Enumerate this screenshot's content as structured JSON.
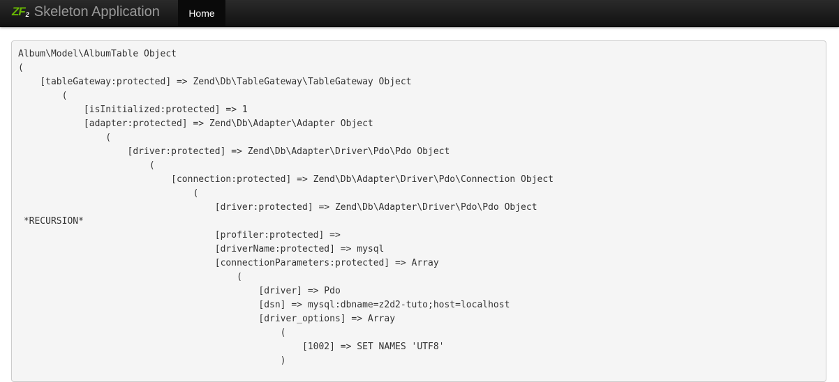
{
  "header": {
    "logo_text": "ZF",
    "logo_version": "2",
    "brand": "Skeleton Application",
    "nav": [
      {
        "label": "Home"
      }
    ]
  },
  "output": {
    "lines": [
      "Album\\Model\\AlbumTable Object",
      "(",
      "    [tableGateway:protected] => Zend\\Db\\TableGateway\\TableGateway Object",
      "        (",
      "            [isInitialized:protected] => 1",
      "            [adapter:protected] => Zend\\Db\\Adapter\\Adapter Object",
      "                (",
      "                    [driver:protected] => Zend\\Db\\Adapter\\Driver\\Pdo\\Pdo Object",
      "                        (",
      "                            [connection:protected] => Zend\\Db\\Adapter\\Driver\\Pdo\\Connection Object",
      "                                (",
      "                                    [driver:protected] => Zend\\Db\\Adapter\\Driver\\Pdo\\Pdo Object",
      " *RECURSION*",
      "                                    [profiler:protected] => ",
      "                                    [driverName:protected] => mysql",
      "                                    [connectionParameters:protected] => Array",
      "                                        (",
      "                                            [driver] => Pdo",
      "                                            [dsn] => mysql:dbname=z2d2-tuto;host=localhost",
      "                                            [driver_options] => Array",
      "                                                (",
      "                                                    [1002] => SET NAMES 'UTF8'",
      "                                                )"
    ]
  }
}
